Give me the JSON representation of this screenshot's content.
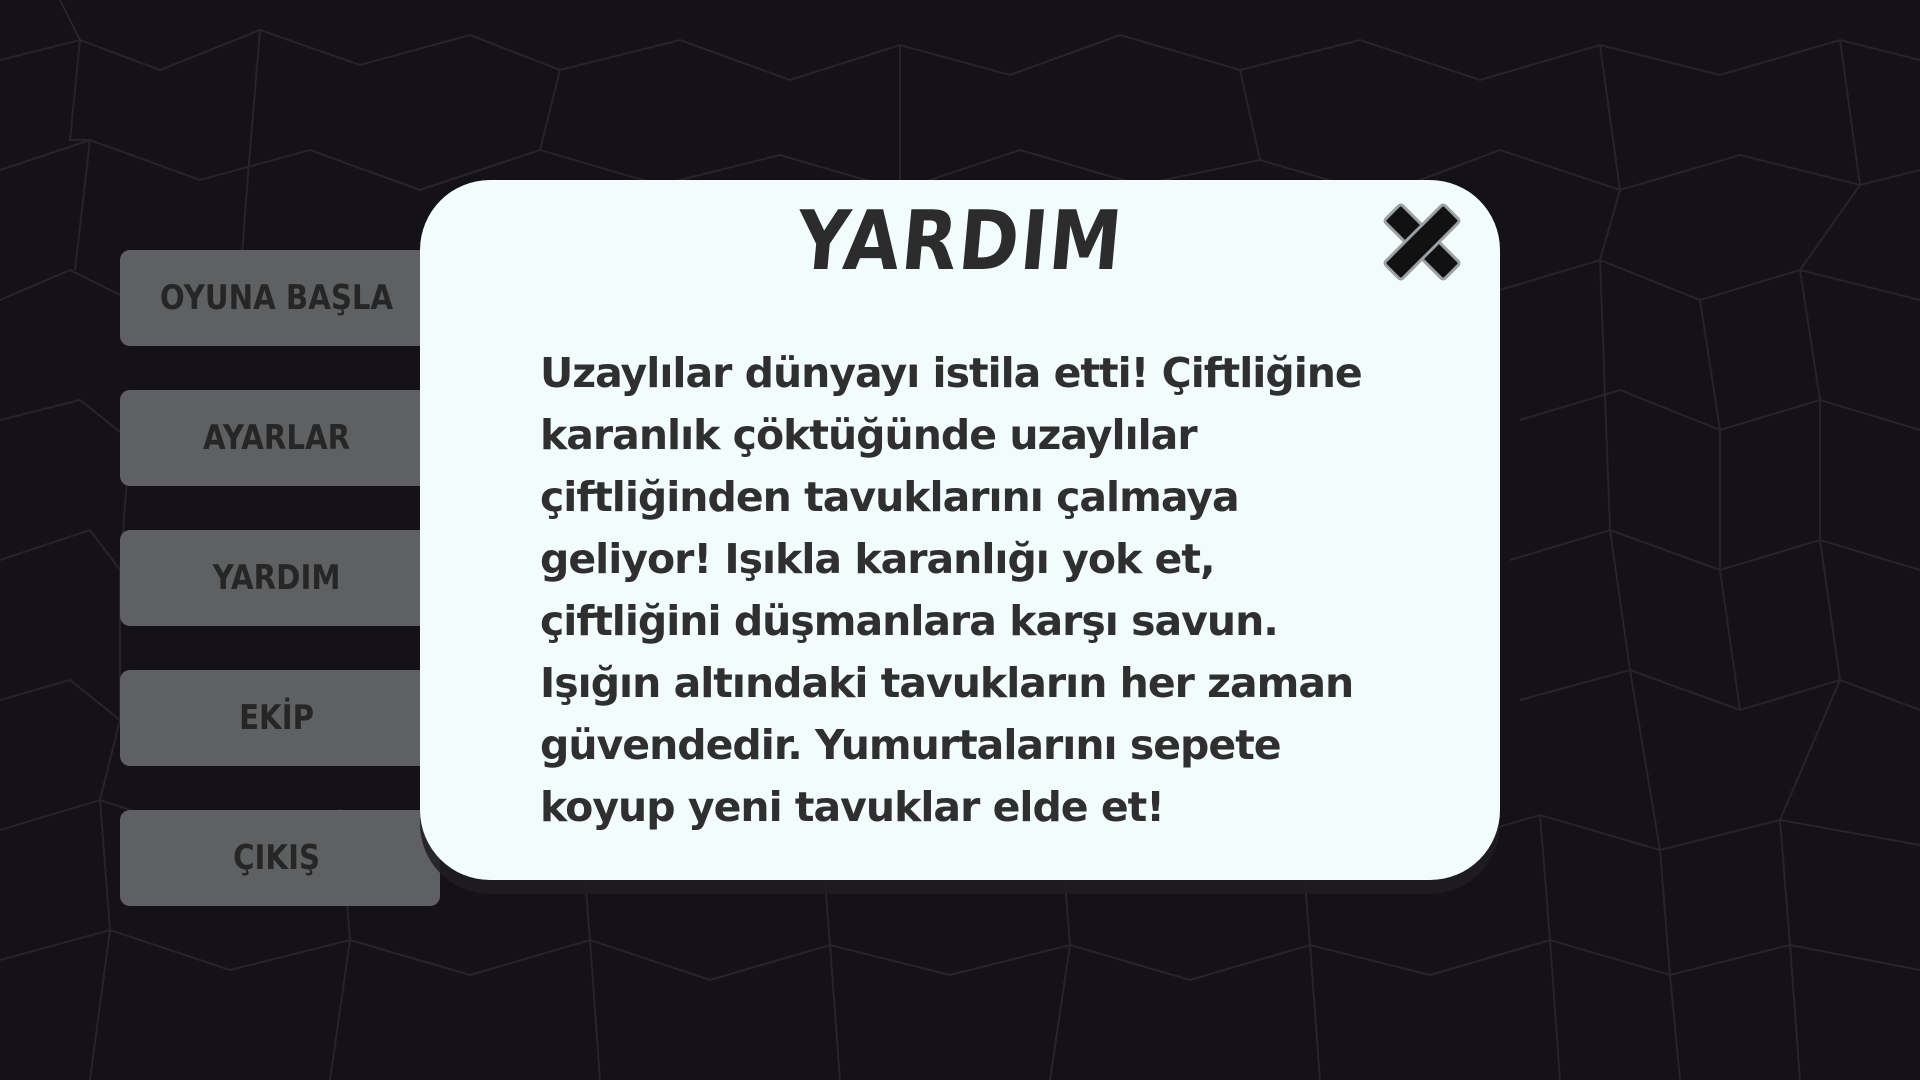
{
  "menu": {
    "items": [
      {
        "label": "OYUNA BAŞLA"
      },
      {
        "label": "AYARLAR"
      },
      {
        "label": "YARDIM"
      },
      {
        "label": "EKİP"
      },
      {
        "label": "ÇIKIŞ"
      }
    ]
  },
  "dialog": {
    "title": "YARDIM",
    "close_icon": "close-x-icon",
    "body": "Uzaylılar dünyayı istila etti! Çiftliğine karanlık çöktüğünde uzaylılar çiftliğinden tavuklarını çalmaya geliyor! Işıkla karanlığı yok et, çiftliğini düşmanlara karşı savun. Işığın altındaki tavukların her zaman güvendedir. Yumurtalarını sepete koyup yeni tavuklar elde et!"
  },
  "colors": {
    "background": "#141118",
    "menu_button": "#5f6061",
    "menu_text": "#262626",
    "dialog_background": "#f2fcfd",
    "dialog_text": "#2f2f2f"
  }
}
